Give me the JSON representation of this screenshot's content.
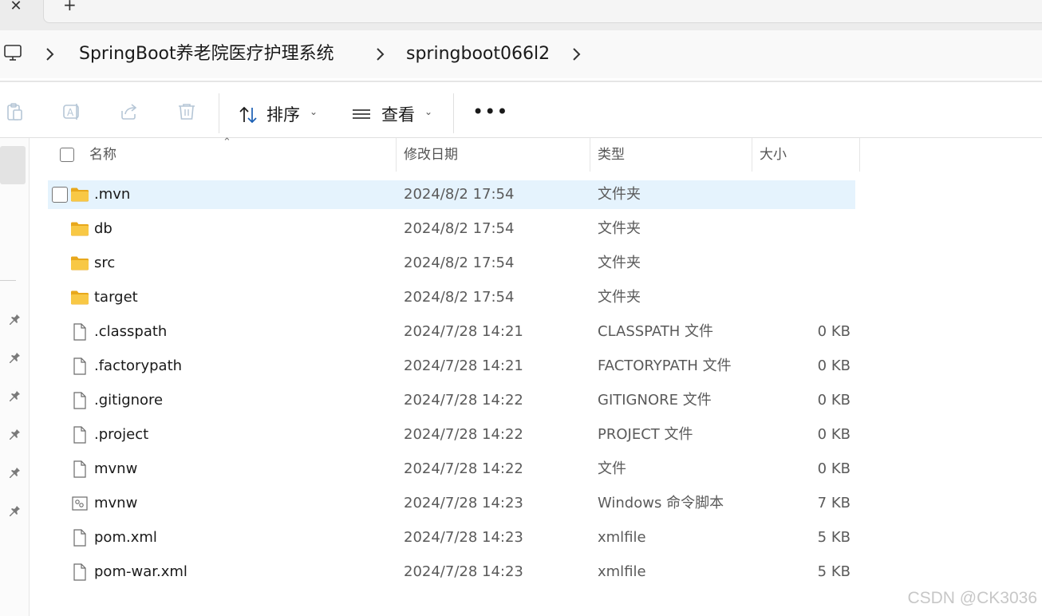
{
  "tabs": {
    "close_glyph": "✕",
    "new_tab_glyph": "+"
  },
  "breadcrumb": {
    "root_icon": "computer-icon",
    "items": [
      "SpringBoot养老院医疗护理系统",
      "springboot066l2"
    ]
  },
  "toolbar": {
    "sort_label": "排序",
    "view_label": "查看",
    "more_glyph": "•••",
    "icons": [
      "paste-icon",
      "rename-icon",
      "share-icon",
      "delete-icon",
      "sort-icon",
      "view-icon",
      "more-icon"
    ]
  },
  "columns": {
    "name": "名称",
    "date": "修改日期",
    "type": "类型",
    "size": "大小"
  },
  "files": [
    {
      "name": ".mvn",
      "date": "2024/8/2 17:54",
      "type": "文件夹",
      "size": "",
      "icon": "folder-icon",
      "selected": true
    },
    {
      "name": "db",
      "date": "2024/8/2 17:54",
      "type": "文件夹",
      "size": "",
      "icon": "folder-icon"
    },
    {
      "name": "src",
      "date": "2024/8/2 17:54",
      "type": "文件夹",
      "size": "",
      "icon": "folder-icon"
    },
    {
      "name": "target",
      "date": "2024/8/2 17:54",
      "type": "文件夹",
      "size": "",
      "icon": "folder-icon"
    },
    {
      "name": ".classpath",
      "date": "2024/7/28 14:21",
      "type": "CLASSPATH 文件",
      "size": "0 KB",
      "icon": "file-icon"
    },
    {
      "name": ".factorypath",
      "date": "2024/7/28 14:21",
      "type": "FACTORYPATH 文件",
      "size": "0 KB",
      "icon": "file-icon"
    },
    {
      "name": ".gitignore",
      "date": "2024/7/28 14:22",
      "type": "GITIGNORE 文件",
      "size": "0 KB",
      "icon": "file-icon"
    },
    {
      "name": ".project",
      "date": "2024/7/28 14:22",
      "type": "PROJECT 文件",
      "size": "0 KB",
      "icon": "file-icon"
    },
    {
      "name": "mvnw",
      "date": "2024/7/28 14:22",
      "type": "文件",
      "size": "0 KB",
      "icon": "file-icon"
    },
    {
      "name": "mvnw",
      "date": "2024/7/28 14:23",
      "type": "Windows 命令脚本",
      "size": "7 KB",
      "icon": "script-file-icon"
    },
    {
      "name": "pom.xml",
      "date": "2024/7/28 14:23",
      "type": "xmlfile",
      "size": "5 KB",
      "icon": "file-icon"
    },
    {
      "name": "pom-war.xml",
      "date": "2024/7/28 14:23",
      "type": "xmlfile",
      "size": "5 KB",
      "icon": "file-icon"
    }
  ],
  "watermark": "CSDN @CK3036",
  "colors": {
    "selection": "#e5f3fd",
    "folder": "#f8c845",
    "folder_dark": "#e8a81c"
  }
}
